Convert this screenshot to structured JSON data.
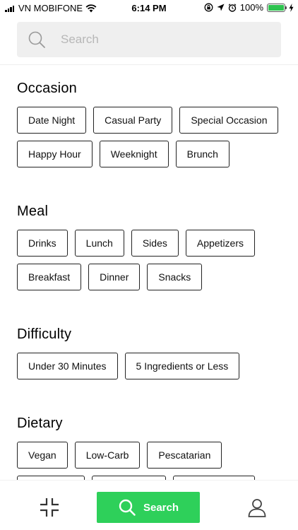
{
  "status_bar": {
    "carrier": "VN MOBIFONE",
    "time": "6:14 PM",
    "battery": "100%",
    "battery_level": 1.0,
    "battery_color": "#2ec34f"
  },
  "search": {
    "placeholder": "Search",
    "value": ""
  },
  "sections": {
    "occasion": {
      "title": "Occasion",
      "chips": [
        "Date Night",
        "Casual Party",
        "Special Occasion",
        "Happy Hour",
        "Weeknight",
        "Brunch"
      ]
    },
    "meal": {
      "title": "Meal",
      "chips": [
        "Drinks",
        "Lunch",
        "Sides",
        "Appetizers",
        "Breakfast",
        "Dinner",
        "Snacks"
      ]
    },
    "difficulty": {
      "title": "Difficulty",
      "chips": [
        "Under 30 Minutes",
        "5 Ingredients or Less"
      ]
    },
    "dietary": {
      "title": "Dietary",
      "chips": [
        "Vegan",
        "Low-Carb",
        "Pescatarian"
      ]
    }
  },
  "tab_bar": {
    "search_label": "Search",
    "accent_color": "#2ed05a",
    "icons": [
      "grid-icon",
      "search-icon",
      "profile-icon"
    ]
  }
}
